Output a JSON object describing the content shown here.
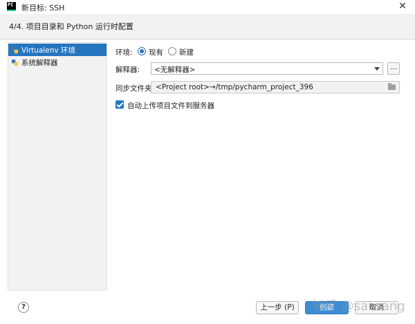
{
  "window": {
    "app_icon": "pycharm-logo-icon",
    "app_icon_text": "PC",
    "title": "新目标: SSH",
    "close_symbol": "✕"
  },
  "step": {
    "text": "4/4. 项目目录和 Python 运行时配置"
  },
  "sidebar": {
    "items": [
      {
        "label": "Virtualenv 环境",
        "icon": "python-icon",
        "selected": true
      },
      {
        "label": "系统解释器",
        "icon": "python-icon",
        "selected": false
      }
    ]
  },
  "form": {
    "env_label": "环境:",
    "env_options": [
      {
        "label": "现有",
        "checked": true
      },
      {
        "label": "新建",
        "checked": false
      }
    ],
    "interpreter_label": "解释器:",
    "interpreter_value": "<无解释器>",
    "more_label": "...",
    "sync_label": "同步文件夹:",
    "sync_value": "<Project root>→/tmp/pycharm_project_396",
    "auto_upload_label": "自动上传项目文件到服务器",
    "auto_upload_checked": true
  },
  "footer": {
    "help_label": "?",
    "prev_label": "上一步 (P)",
    "create_label": "创建",
    "cancel_label": "取消"
  },
  "watermark": "知乎 @saiwang",
  "colors": {
    "accent": "#2675bf",
    "primary_button": "#3c8dd6",
    "panel_bg": "#f2f2f2"
  }
}
